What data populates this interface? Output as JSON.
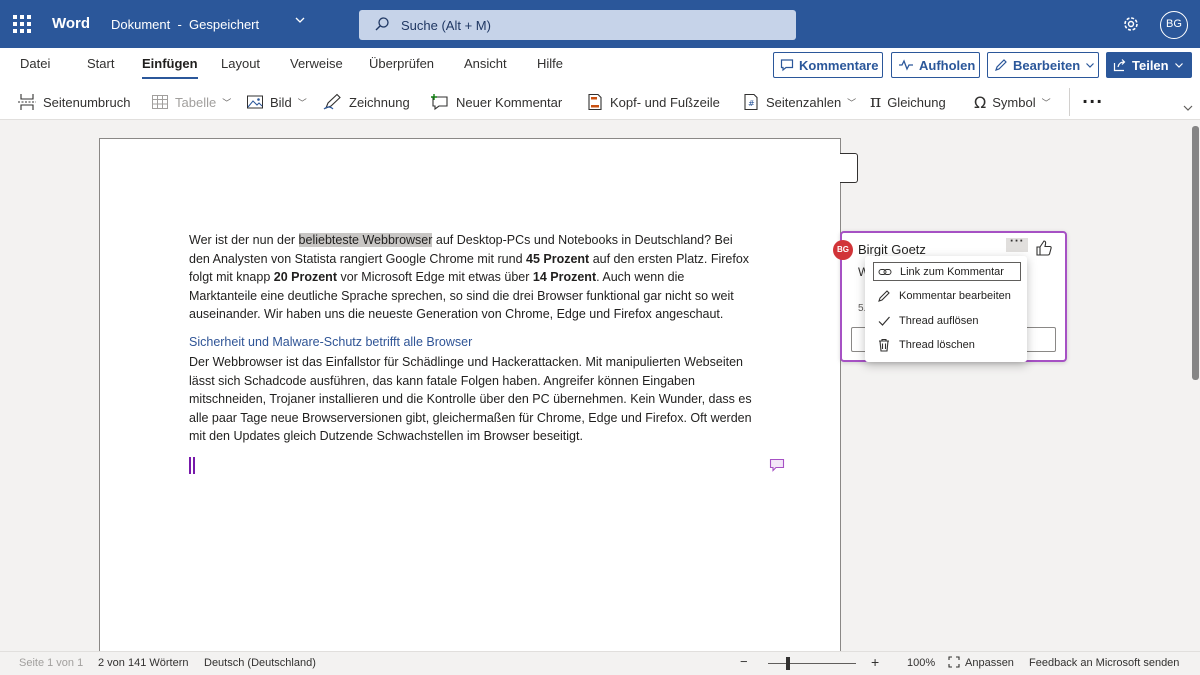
{
  "titlebar": {
    "app_name": "Word",
    "doc_name": "Dokument  -  Gespeichert",
    "search_placeholder": "Suche (Alt + M)",
    "user_initials": "BG"
  },
  "tabs": [
    {
      "label": "Datei",
      "active": false
    },
    {
      "label": "Start",
      "active": false
    },
    {
      "label": "Einfügen",
      "active": true
    },
    {
      "label": "Layout",
      "active": false
    },
    {
      "label": "Verweise",
      "active": false
    },
    {
      "label": "Überprüfen",
      "active": false
    },
    {
      "label": "Ansicht",
      "active": false
    },
    {
      "label": "Hilfe",
      "active": false
    }
  ],
  "actions": {
    "comments": "Kommentare",
    "catchup": "Aufholen",
    "edit": "Bearbeiten",
    "share": "Teilen"
  },
  "ribbon": {
    "page_break": "Seitenumbruch",
    "table": "Tabelle",
    "picture": "Bild",
    "drawing": "Zeichnung",
    "new_comment": "Neuer Kommentar",
    "header_footer": "Kopf- und Fußzeile",
    "page_numbers": "Seitenzahlen",
    "equation": "Gleichung",
    "symbol": "Symbol",
    "more": "···"
  },
  "document": {
    "p1": {
      "a": "Wer ist der nun der ",
      "highlight": "beliebteste Webbrowser",
      "b": " auf Desktop-PCs und Notebooks in Deutschland? Bei den Analysten von Statista rangiert Google Chrome mit rund ",
      "bold1": "45 Prozent",
      "c": " auf den ersten Platz. Firefox folgt mit knapp ",
      "bold2": "20 Prozent",
      "d": " vor Microsoft Edge mit etwas über ",
      "bold3": "14 Prozent",
      "e": ". Auch wenn die Marktanteile eine deutliche Sprache sprechen, so sind die drei Browser funktional gar nicht so weit auseinander. Wir haben uns die neueste Generation von Chrome, Edge und Firefox angeschaut."
    },
    "heading": "Sicherheit und Malware-Schutz betrifft alle Browser",
    "p2": "Der Webbrowser ist das Einfallstor für Schädlinge und Hackerattacken. Mit manipulierten Webseiten lässt sich Schadcode ausführen, das kann fatale Folgen haben. Angreifer können Eingaben mitschneiden, Trojaner installieren und die Kontrolle über den PC übernehmen. Kein Wunder, dass es alle paar Tage neue Browserversionen gibt, gleichermaßen für Chrome, Edge und Firefox. Oft werden mit den Updates gleich Dutzende Schwachstellen im Browser beseitigt."
  },
  "comment": {
    "avatar": "BG",
    "author": "Birgit Goetz",
    "partial1": "W",
    "partial2": "5."
  },
  "context_menu": [
    {
      "label": "Link zum Kommentar",
      "icon": "link-icon"
    },
    {
      "label": "Kommentar bearbeiten",
      "icon": "pencil-icon"
    },
    {
      "label": "Thread auflösen",
      "icon": "check-icon"
    },
    {
      "label": "Thread löschen",
      "icon": "trash-icon"
    }
  ],
  "statusbar": {
    "page": "Seite 1 von 1",
    "words": "2 von 141 Wörtern",
    "language": "Deutsch (Deutschland)",
    "zoom_minus": "−",
    "zoom_plus": "+",
    "zoom": "100%",
    "fit": "Anpassen",
    "feedback": "Feedback an Microsoft senden"
  },
  "colors": {
    "brand": "#2b579a",
    "comment_border": "#a651c4",
    "avatar": "#d13438",
    "heading": "#2f5496"
  }
}
